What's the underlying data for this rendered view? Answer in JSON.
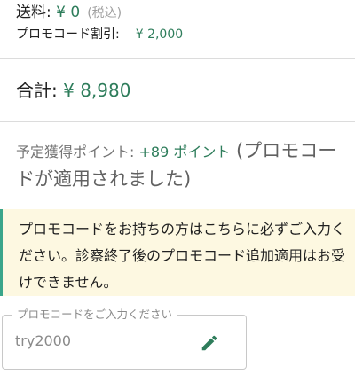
{
  "summary": {
    "shipping_label": "送料: ",
    "shipping_value": "¥ 0",
    "shipping_tax": "(税込)",
    "promo_label": "プロモコード割引:",
    "promo_value": "¥ 2,000",
    "total_label": "合計: ",
    "total_value": "¥ 8,980"
  },
  "points": {
    "lead": "予定獲得ポイント: ",
    "value": "+89 ポイント",
    "note": " (プロモコードが適用されました)"
  },
  "notice": {
    "text": "プロモコードをお持ちの方はこちらに必ずご入力ください。診察終了後のプロモコード追加適用はお受けできません。"
  },
  "promo_field": {
    "label": "プロモコードをご入力ください",
    "value": "try2000",
    "icon": "pencil-icon"
  },
  "colors": {
    "accent": "#2e7d5b",
    "notice_bg": "#fdf8e1",
    "notice_border": "#3aa58a"
  }
}
